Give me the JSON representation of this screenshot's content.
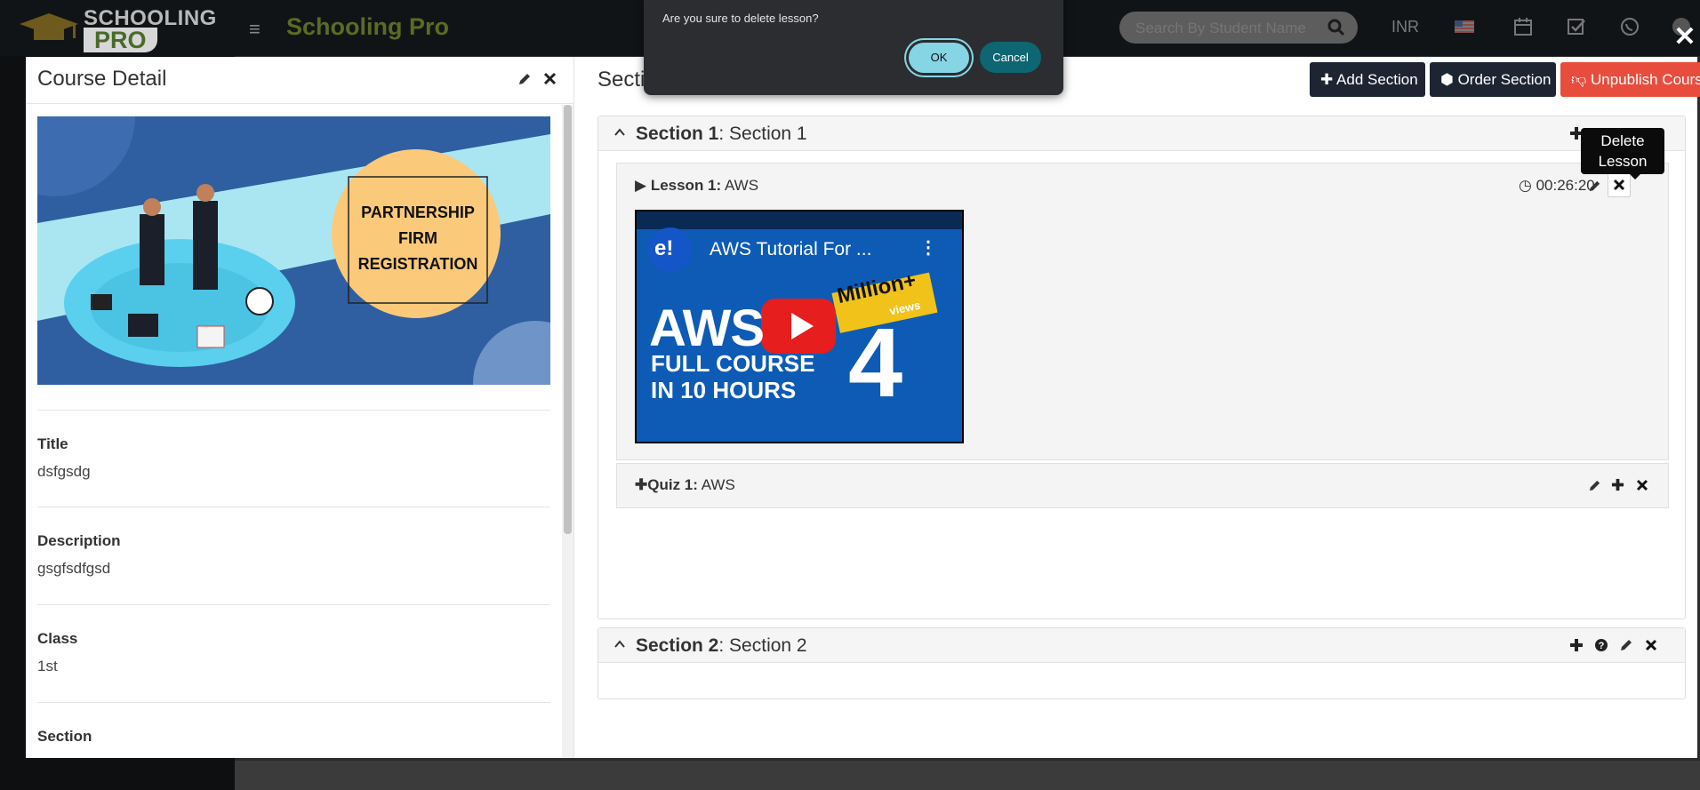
{
  "app": {
    "logo_line1": "SCHOOLING",
    "logo_line2": "PRO",
    "brand": "Schooling Pro",
    "search_placeholder": "Search By Student Name",
    "currency": "INR"
  },
  "modal": {
    "course_detail_title": "Course Detail",
    "thumbnail_text": [
      "PARTNERSHIP",
      "FIRM",
      "REGISTRATION"
    ],
    "fields": [
      {
        "label": "Title",
        "value": "dsfgsdg"
      },
      {
        "label": "Description",
        "value": "gsgfsdfgsd"
      },
      {
        "label": "Class",
        "value": "1st"
      },
      {
        "label": "Section",
        "value": ""
      }
    ],
    "sections_title": "Sections",
    "buttons": {
      "add_section": "Add Section",
      "order_section": "Order Section",
      "unpublish_course": "Unpublish Course"
    },
    "sections": [
      {
        "label": "Section 1",
        "name": ": Section 1"
      },
      {
        "label": "Section 2",
        "name": ": Section 2"
      }
    ],
    "lesson": {
      "label": "Lesson 1:",
      "name": " AWS",
      "duration": "00:26:20"
    },
    "video": {
      "title": "AWS Tutorial For ...",
      "big_text": "AWS",
      "line1": "FULL COURSE",
      "line2": "IN 10 HOURS",
      "badge": "Million+",
      "badge_sub": "views",
      "number": "4"
    },
    "quiz": {
      "label": "Quiz 1:",
      "name": " AWS"
    },
    "tooltip": "Delete Lesson"
  },
  "confirm": {
    "message": "Are you sure to delete lesson?",
    "ok": "OK",
    "cancel": "Cancel"
  },
  "colors": {
    "brand_green": "#5c6b23",
    "dark_button": "#1d2533",
    "red_button": "#e74c3c",
    "ok_button": "#86d5e4",
    "cancel_button": "#0e6672"
  }
}
